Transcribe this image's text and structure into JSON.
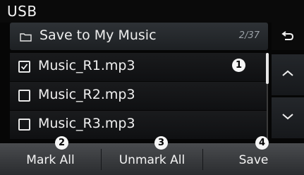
{
  "window": {
    "title": "USB"
  },
  "header": {
    "label": "Save to My Music",
    "page_count": "2/37"
  },
  "files": [
    {
      "name": "Music_R1.mp3",
      "checked": true
    },
    {
      "name": "Music_R2.mp3",
      "checked": false
    },
    {
      "name": "Music_R3.mp3",
      "checked": false
    }
  ],
  "callouts": [
    "1",
    "2",
    "3",
    "4"
  ],
  "bottom": {
    "mark_all": "Mark All",
    "unmark_all": "Unmark All",
    "save": "Save"
  },
  "icons": {
    "folder": "folder-icon",
    "back": "back-arrow-icon",
    "up": "chevron-up-icon",
    "down": "chevron-down-icon",
    "check": "checkmark-icon"
  },
  "colors": {
    "background": "#060606",
    "bottom_bar": "#3b3d40",
    "text": "#f2f2f2"
  }
}
